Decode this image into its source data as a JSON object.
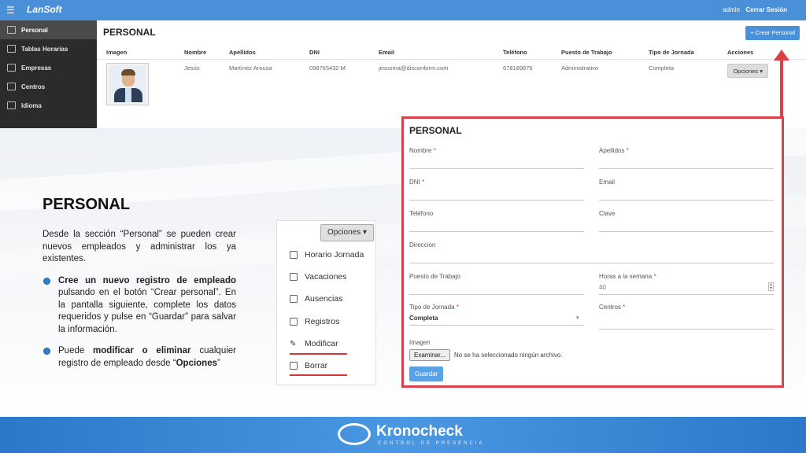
{
  "navbar": {
    "menu_icon": "☰",
    "logo": "LanSoft",
    "user": "admin",
    "logout": "Cerrar Sesión"
  },
  "sidebar": {
    "items": [
      {
        "label": "Personal",
        "active": true
      },
      {
        "label": "Tablas Horarias"
      },
      {
        "label": "Empresas"
      },
      {
        "label": "Centros"
      },
      {
        "label": "Idioma"
      }
    ]
  },
  "main": {
    "title": "PERSONAL",
    "create_button": "+ Crear Personal",
    "columns": [
      "Imagen",
      "Nombre",
      "Apellidos",
      "DNI",
      "Email",
      "Teléfono",
      "Puesto de Trabajo",
      "Tipo de Jornada",
      "Acciones"
    ],
    "row": {
      "nombre": "Jesús",
      "apellidos": "Martínez Arousa",
      "dni": "098765432 M",
      "email": "jesusma@disconform.com",
      "telefono": "678189876",
      "puesto": "Administrativo",
      "jornada": "Completa",
      "acciones": "Opciones ▾"
    }
  },
  "slide": {
    "title": "PERSONAL",
    "intro": "Desde la sección “Personal” se pueden crear nuevos empleados y administrar los ya existentes.",
    "bullet1_bold": "Cree un nuevo registro de empleado",
    "bullet1_rest": " pulsando en el botón “Crear personal”. En la pantalla siguiente, complete los datos requeridos y pulse en “Guardar” para salvar la información.",
    "bullet2_pre": "Puede ",
    "bullet2_bold": "modificar o eliminar",
    "bullet2_mid": " cualquier registro de empleado desde “",
    "bullet2_bold2": "Opciones",
    "bullet2_end": "”"
  },
  "options": {
    "button": "Opciones ▾",
    "items": [
      "Horario Jornada",
      "Vacaciones",
      "Ausencias",
      "Registros",
      "Modificar",
      "Borrar"
    ]
  },
  "form": {
    "title": "PERSONAL",
    "nombre": "Nombre",
    "apellidos": "Apellidos",
    "dni": "DNI",
    "email": "Email",
    "telefono": "Teléfono",
    "clave": "Clave",
    "direccion": "Direccion",
    "puesto": "Puesto de Trabajo",
    "horas": "Horas a la semana",
    "horas_value": "40",
    "jornada": "Tipo de Jornada",
    "jornada_value": "Completa",
    "centros": "Centros",
    "imagen": "Imagen",
    "file_button": "Examinar...",
    "file_text": "No se ha seleccionado ningún archivo.",
    "save": "Guardar",
    "required_mark": "*"
  },
  "footer": {
    "brand": "Kronocheck",
    "sub": "CONTROL DE PRESENCIA"
  },
  "colors": {
    "accent": "#4a90d9",
    "highlight": "#d9404a"
  }
}
